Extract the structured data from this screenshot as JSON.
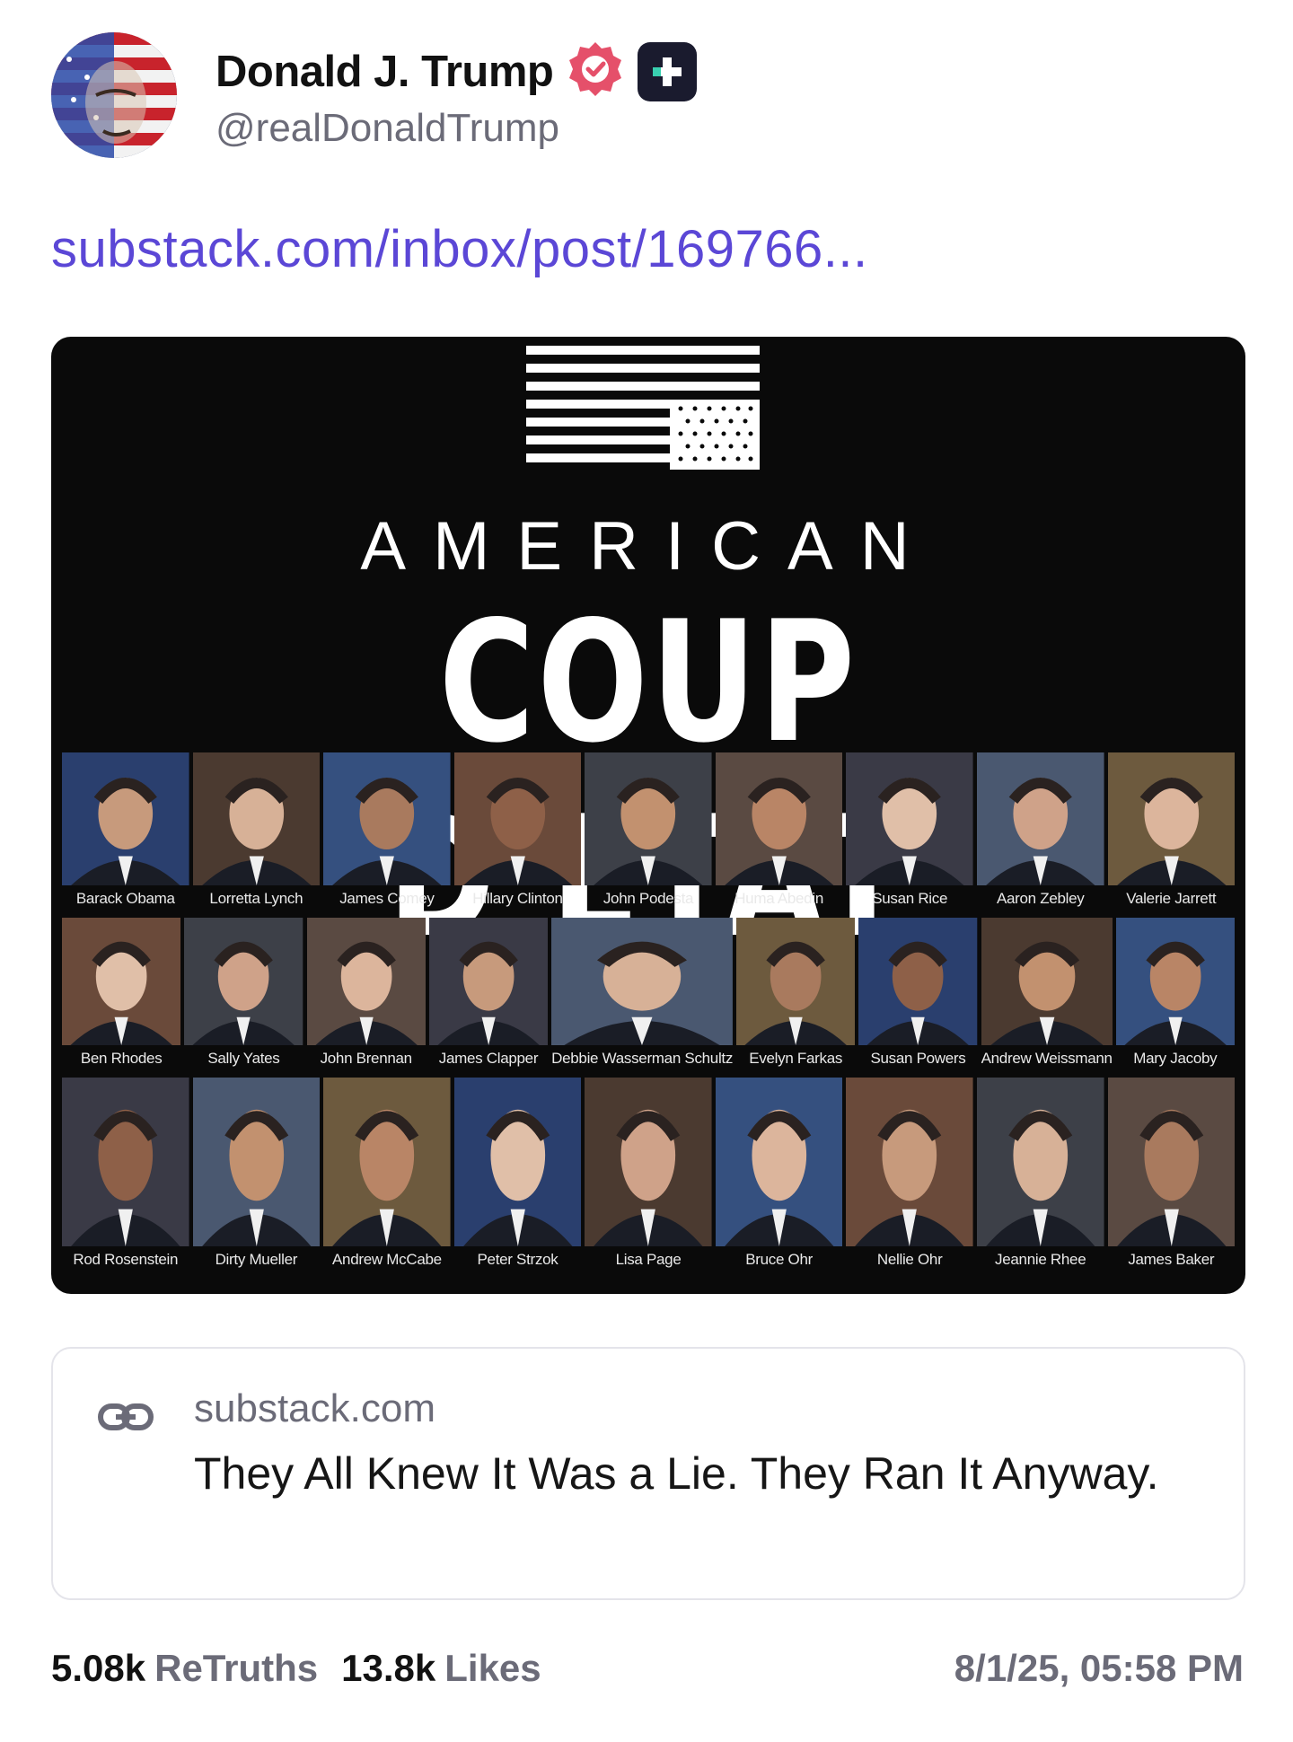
{
  "author": {
    "display_name": "Donald J. Trump",
    "handle": "@realDonaldTrump"
  },
  "post": {
    "link_text": "substack.com/inbox/post/169766...",
    "image": {
      "heading_small": "AMERICAN",
      "heading_large": "COUP D’ETAT",
      "rows": [
        [
          "Barack Obama",
          "Lorretta Lynch",
          "James Comey",
          "Hillary Clinton",
          "John Podesta",
          "Huma Abedin",
          "Susan Rice",
          "Aaron Zebley",
          "Valerie Jarrett"
        ],
        [
          "Ben Rhodes",
          "Sally Yates",
          "John Brennan",
          "James Clapper",
          "Debbie Wasserman Schultz",
          "Evelyn Farkas",
          "Susan Powers",
          "Andrew Weissmann",
          "Mary Jacoby"
        ],
        [
          "Rod Rosenstein",
          "Dirty Mueller",
          "Andrew McCabe",
          "Peter Strzok",
          "Lisa Page",
          "Bruce Ohr",
          "Nellie Ohr",
          "Jeannie Rhee",
          "James Baker"
        ]
      ]
    }
  },
  "link_card": {
    "domain": "substack.com",
    "title": "They All Knew It Was a Lie. They Ran It Anyway."
  },
  "stats": {
    "retruths_count": "5.08k",
    "retruths_label": "ReTruths",
    "likes_count": "13.8k",
    "likes_label": "Likes",
    "timestamp": "8/1/25, 05:58 PM"
  },
  "colors": {
    "link": "#5b47d6",
    "verified": "#e5506a",
    "muted": "#6b6b78"
  },
  "icons": [
    "verified-badge-icon",
    "truth-plus-icon",
    "link-icon"
  ]
}
